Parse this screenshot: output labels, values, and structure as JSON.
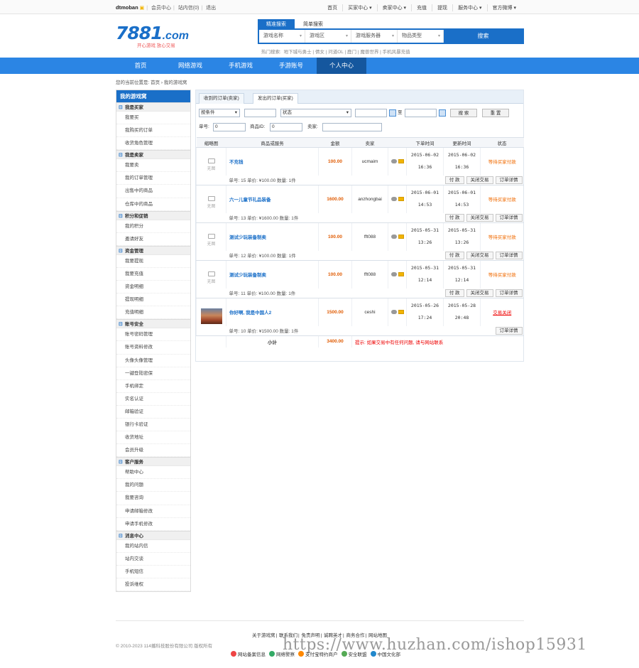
{
  "topbar": {
    "user": "dtmoban",
    "member_center": "会员中心",
    "messages": "站内信(0)",
    "logout": "退出",
    "links": [
      "首页",
      "买家中心 ▾",
      "卖家中心 ▾",
      "充值",
      "提现",
      "服务中心 ▾",
      "官方微博 ▾"
    ]
  },
  "logo": {
    "num": "7881",
    "com": ".com",
    "slogan": "开心游戏 放心交易"
  },
  "search": {
    "tabs": [
      "精准搜索",
      "简单搜索"
    ],
    "selects": [
      "游戏名称",
      "游戏区",
      "游戏服务器",
      "物品类型"
    ],
    "button": "搜索",
    "hot_label": "热门搜索:",
    "hot": [
      "地下城与勇士",
      "倩女",
      "问道OL",
      "鹿门",
      "魔兽世界",
      "手机风暴充值"
    ]
  },
  "nav": [
    "首页",
    "网络游戏",
    "手机游戏",
    "手游账号",
    "个人中心"
  ],
  "breadcrumb": "您的当前位置是: 首页 › 我的游戏窝",
  "sidebar": {
    "title": "我的游戏窝",
    "sections": [
      {
        "title": "我是买家",
        "items": [
          "我要买",
          "我购买的订单",
          "收货角色管理"
        ]
      },
      {
        "title": "我是卖家",
        "items": [
          "我要卖",
          "我的订单管理",
          "出售中的商品",
          "仓库中的商品"
        ]
      },
      {
        "title": "积分和促销",
        "items": [
          "我的积分",
          "邀请好友"
        ]
      },
      {
        "title": "资金管理",
        "items": [
          "我要提现",
          "我要充值",
          "资金明细",
          "提现明细",
          "充值明细"
        ]
      },
      {
        "title": "账号安全",
        "items": [
          "账号密码管理",
          "账号资料修改",
          "头像头像管理",
          "一键登陆密保",
          "手机绑定",
          "实名认证",
          "邮箱验证",
          "银行卡验证",
          "收货地址",
          "会员升级"
        ]
      },
      {
        "title": "客户服务",
        "items": [
          "帮助中心",
          "我的问题",
          "我要咨询",
          "申请邮箱修改",
          "申请手机修改"
        ]
      },
      {
        "title": "消息中心",
        "items": [
          "我的站内信",
          "站内交谈",
          "手机短信",
          "投诉维权"
        ]
      }
    ]
  },
  "main": {
    "tabs": [
      "收到的订单(卖家)",
      "发出的订单(买家)"
    ],
    "filter": {
      "cond": "按条件",
      "status": "状态",
      "to": "至",
      "search": "搜 索",
      "reset": "重 置",
      "order_no_label": "单号:",
      "order_no": "0",
      "goods_id_label": "商品ID:",
      "goods_id": "0",
      "seller_label": "卖家:"
    },
    "columns": [
      "缩略图",
      "商品或服务",
      "金额",
      "卖家",
      "",
      "下单时间",
      "更新时间",
      "状态"
    ],
    "no_image": "无图",
    "orders": [
      {
        "name": "不充钱",
        "amount": "100.00",
        "seller": "ucmaim",
        "created": [
          "2015-06-02",
          "16:36"
        ],
        "updated": [
          "2015-06-02",
          "16:36"
        ],
        "status": "等待买家付款",
        "status_style": "orange",
        "meta": "单号: 15    单价: ¥100.00    数量: 1件",
        "actions": [
          "付 款",
          "关闭交易",
          "订单详情"
        ],
        "photo": false
      },
      {
        "name": "六一儿童节礼品装备",
        "amount": "1600.00",
        "seller": "anzhongbai",
        "created": [
          "2015-06-01",
          "14:53"
        ],
        "updated": [
          "2015-06-01",
          "14:53"
        ],
        "status": "等待买家付款",
        "status_style": "orange",
        "meta": "单号: 13    单价: ¥1600.00    数量: 1件",
        "actions": [
          "付 款",
          "关闭交易",
          "订单详情"
        ],
        "photo": false
      },
      {
        "name": "测试少玩装备制卖",
        "amount": "100.00",
        "seller": "fft088",
        "created": [
          "2015-05-31",
          "13:26"
        ],
        "updated": [
          "2015-05-31",
          "13:26"
        ],
        "status": "等待买家付款",
        "status_style": "orange",
        "meta": "单号: 12    单价: ¥100.00    数量: 1件",
        "actions": [
          "付 款",
          "关闭交易",
          "订单详情"
        ],
        "photo": false
      },
      {
        "name": "测试少玩装备制卖",
        "amount": "100.00",
        "seller": "fft088",
        "created": [
          "2015-05-31",
          "12:14"
        ],
        "updated": [
          "2015-05-31",
          "12:14"
        ],
        "status": "等待买家付款",
        "status_style": "orange",
        "meta": "单号: 11    单价: ¥100.00    数量: 1件",
        "actions": [
          "付 款",
          "关闭交易",
          "订单详情"
        ],
        "photo": false
      },
      {
        "name": "你好啊, 我是中国人2",
        "amount": "1500.00",
        "seller": "ceshi",
        "created": [
          "2015-05-26",
          "17:24"
        ],
        "updated": [
          "2015-05-28",
          "20:48"
        ],
        "status": "交易关闭",
        "status_style": "red",
        "meta": "单号: 10    单价: ¥1500.00    数量: 1件",
        "actions": [
          "订单详情"
        ],
        "photo": true
      }
    ],
    "total_label": "小计",
    "total": "3400.00",
    "tip": "提示: 如果交易中有任何问题, 请与网站联系"
  },
  "footer": {
    "links": [
      "关于游戏窝",
      "联系我们",
      "免责声明",
      "诚聘英才",
      "商务合作",
      "网站地图"
    ],
    "copyright": "© 2010-2023 114播科技股份有限公司 版权所有",
    "badges": [
      "网站备案信息",
      "网络警察",
      "支付宝特约商户",
      "安全联盟",
      "中国文化部"
    ],
    "watermark": "https://www.huzhan.com/ishop15931"
  },
  "colors": {
    "brand": "#1a6fc8",
    "nav": "#2b85e4",
    "accent": "#e05a00",
    "alert": "#e00000"
  }
}
